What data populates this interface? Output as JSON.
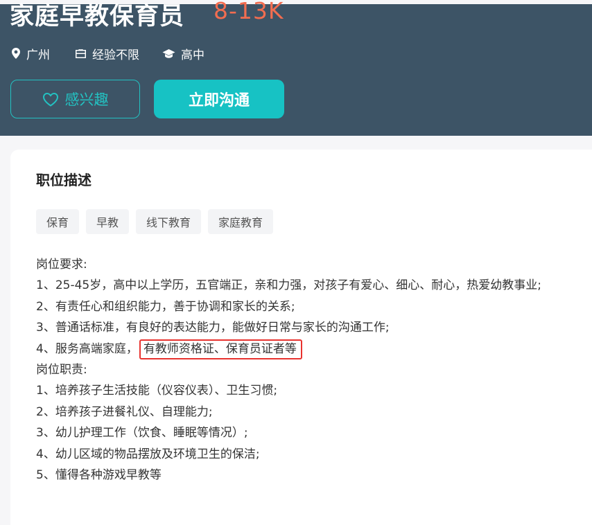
{
  "job": {
    "title": "家庭早教保育员",
    "salary": "8-13K",
    "location": "广州",
    "experience": "经验不限",
    "education": "高中"
  },
  "actions": {
    "interest_label": "感兴趣",
    "chat_label": "立即沟通"
  },
  "description": {
    "title": "职位描述",
    "tags": [
      "保育",
      "早教",
      "线下教育",
      "家庭教育"
    ],
    "lines": [
      "岗位要求:",
      "1、25-45岁，高中以上学历，五官端正，亲和力强，对孩子有爱心、细心、耐心，热爱幼教事业;",
      "2、有责任心和组织能力，善于协调和家长的关系;",
      "3、普通话标准，有良好的表达能力，能做好日常与家长的沟通工作;",
      "4、服务高端家庭，",
      "岗位职责:",
      "1、培养孩子生活技能（仪容仪表）、卫生习惯;",
      "2、培养孩子进餐礼仪、自理能力;",
      "3、幼儿护理工作（饮食、睡眠等情况）;",
      "4、幼儿区域的物品摆放及环境卫生的保洁;",
      "5、懂得各种游戏早教等"
    ],
    "highlight": "有教师资格证、保育员证者等"
  },
  "colors": {
    "header_bg": "#3d5466",
    "accent": "#17c2c4",
    "salary": "#f26d50",
    "highlight_border": "#e8322e"
  },
  "icons": {
    "location": "location-pin-icon",
    "experience": "briefcase-icon",
    "education": "graduation-cap-icon",
    "interest": "heart-icon"
  }
}
